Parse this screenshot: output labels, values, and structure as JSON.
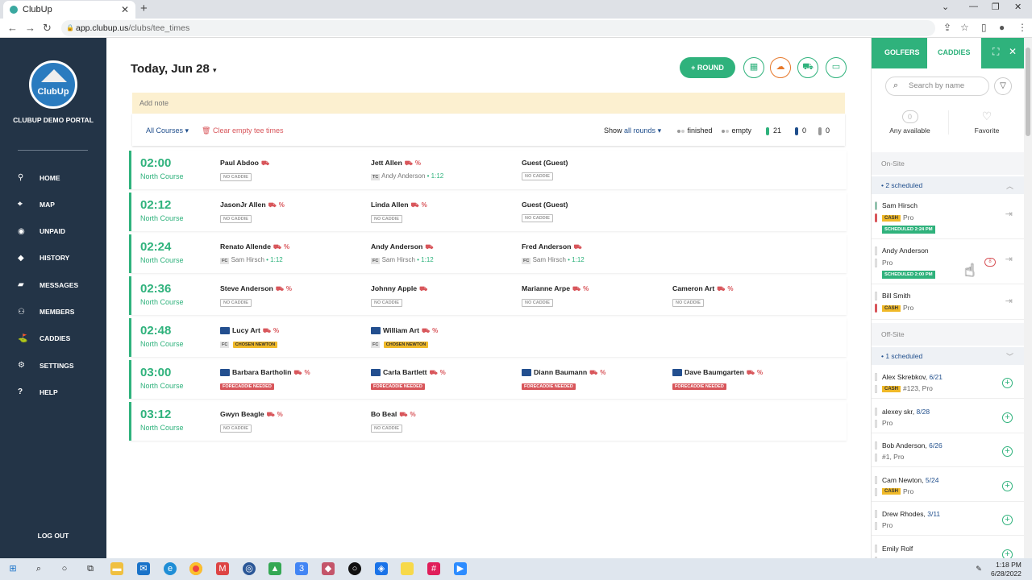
{
  "browser": {
    "tab_title": "ClubUp",
    "url_host": "app.clubup.us",
    "url_path": "/clubs/tee_times"
  },
  "sidebar": {
    "logo_text": "ClubUp",
    "portal_name": "CLUBUP DEMO PORTAL",
    "items": [
      {
        "label": "HOME",
        "icon": "pin-icon"
      },
      {
        "label": "MAP",
        "icon": "map-icon"
      },
      {
        "label": "UNPAID",
        "icon": "unpaid-icon"
      },
      {
        "label": "HISTORY",
        "icon": "history-icon"
      },
      {
        "label": "MESSAGES",
        "icon": "messages-icon"
      },
      {
        "label": "MEMBERS",
        "icon": "members-icon"
      },
      {
        "label": "CADDIES",
        "icon": "caddies-icon"
      },
      {
        "label": "SETTINGS",
        "icon": "gear-icon"
      },
      {
        "label": "HELP",
        "icon": "help-icon"
      }
    ],
    "logout": "LOG OUT"
  },
  "header": {
    "date": "Today, Jun 28",
    "round_button": "ROUND"
  },
  "note": {
    "placeholder": "Add note"
  },
  "filters": {
    "courses": "All Courses",
    "clear": "Clear empty tee times",
    "show_label": "Show",
    "show_value": "all rounds",
    "finished": "finished",
    "empty": "empty",
    "count_green": "21",
    "count_blue": "0",
    "count_gray": "0"
  },
  "tee_times": [
    {
      "time": "02:00",
      "course": "North Course",
      "players": [
        {
          "name": "Paul Abdoo",
          "pct": false,
          "member": false,
          "tag": "NO CADDIE",
          "tag_type": "nocad"
        },
        {
          "name": "Jett Allen",
          "pct": true,
          "member": false,
          "abbr": "TC",
          "caddie": "Andy Anderson",
          "cad_num": "• 1:12"
        },
        {
          "name": "Guest (Guest)",
          "pct": false,
          "car": false,
          "member": false,
          "tag": "NO CADDIE",
          "tag_type": "nocad"
        }
      ]
    },
    {
      "time": "02:12",
      "course": "North Course",
      "players": [
        {
          "name": "JasonJr Allen",
          "pct": true,
          "member": false,
          "tag": "NO CADDIE",
          "tag_type": "nocad"
        },
        {
          "name": "Linda Allen",
          "pct": true,
          "member": false,
          "tag": "NO CADDIE",
          "tag_type": "nocad"
        },
        {
          "name": "Guest (Guest)",
          "pct": false,
          "car": false,
          "member": false,
          "tag": "NO CADDIE",
          "tag_type": "nocad"
        }
      ]
    },
    {
      "time": "02:24",
      "course": "North Course",
      "players": [
        {
          "name": "Renato Allende",
          "pct": true,
          "member": false,
          "abbr": "FC",
          "caddie": "Sam Hirsch",
          "cad_num": "• 1:12"
        },
        {
          "name": "Andy Anderson",
          "pct": false,
          "member": false,
          "abbr": "FC",
          "caddie": "Sam Hirsch",
          "cad_num": "• 1:12"
        },
        {
          "name": "Fred Anderson",
          "pct": false,
          "member": false,
          "abbr": "FC",
          "caddie": "Sam Hirsch",
          "cad_num": "• 1:12"
        }
      ]
    },
    {
      "time": "02:36",
      "course": "North Course",
      "players": [
        {
          "name": "Steve Anderson",
          "pct": true,
          "member": false,
          "tag": "NO CADDIE",
          "tag_type": "nocad"
        },
        {
          "name": "Johnny Apple",
          "pct": false,
          "member": false,
          "tag": "NO CADDIE",
          "tag_type": "nocad"
        },
        {
          "name": "Marianne Arpe",
          "pct": true,
          "member": false,
          "tag": "NO CADDIE",
          "tag_type": "nocad"
        },
        {
          "name": "Cameron Art",
          "pct": true,
          "member": false,
          "tag": "NO CADDIE",
          "tag_type": "nocad"
        }
      ]
    },
    {
      "time": "02:48",
      "course": "North Course",
      "players": [
        {
          "name": "Lucy Art",
          "pct": true,
          "member": true,
          "abbr": "FC",
          "tag": "CHOSEN NEWTON",
          "tag_type": "cn"
        },
        {
          "name": "William Art",
          "pct": true,
          "member": true,
          "abbr": "FC",
          "tag": "CHOSEN NEWTON",
          "tag_type": "cn"
        }
      ]
    },
    {
      "time": "03:00",
      "course": "North Course",
      "players": [
        {
          "name": "Barbara Bartholin",
          "pct": true,
          "member": true,
          "tag": "FORECADDIE NEEDED",
          "tag_type": "fn"
        },
        {
          "name": "Carla Bartlett",
          "pct": true,
          "member": true,
          "tag": "FORECADDIE NEEDED",
          "tag_type": "fn"
        },
        {
          "name": "Diann Baumann",
          "pct": true,
          "member": true,
          "tag": "FORECADDIE NEEDED",
          "tag_type": "fn"
        },
        {
          "name": "Dave Baumgarten",
          "pct": true,
          "member": true,
          "tag": "FORECADDIE NEEDED",
          "tag_type": "fn"
        }
      ]
    },
    {
      "time": "03:12",
      "course": "North Course",
      "players": [
        {
          "name": "Gwyn Beagle",
          "pct": true,
          "member": false,
          "tag": "NO CADDIE",
          "tag_type": "nocad"
        },
        {
          "name": "Bo Beal",
          "pct": true,
          "member": false,
          "tag": "NO CADDIE",
          "tag_type": "nocad"
        }
      ]
    }
  ],
  "rpanel": {
    "tab_golfers": "GOLFERS",
    "tab_caddies": "CADDIES",
    "search_placeholder": "Search by name",
    "opt_any": "Any available",
    "opt_any_count": "0",
    "opt_fav": "Favorite",
    "onsite": "On-Site",
    "onsite_sched": "2 scheduled",
    "offsite": "Off-Site",
    "offsite_sched": "1 scheduled",
    "onsite_caddies": [
      {
        "name": "Sam Hirsch",
        "cash": true,
        "sub": "Pro",
        "sched": "SCHEDULED 2:24 PM",
        "bar": "#2fb27c"
      },
      {
        "name": "Andy Anderson",
        "cash": false,
        "sub": "Pro",
        "sched": "SCHEDULED 2:00 PM",
        "bar": "#fff",
        "badge": "8"
      },
      {
        "name": "Bill Smith",
        "cash": true,
        "sub": "Pro",
        "sched": "",
        "bar": "#fff"
      }
    ],
    "offsite_caddies": [
      {
        "name": "Alex Skrebkov",
        "date": "6/21",
        "cash": true,
        "sub": "#123, Pro"
      },
      {
        "name": "alexey skr",
        "date": "8/28",
        "cash": false,
        "sub": "Pro"
      },
      {
        "name": "Bob Anderson",
        "date": "6/26",
        "cash": false,
        "sub": "#1, Pro"
      },
      {
        "name": "Cam Newton",
        "date": "5/24",
        "cash": true,
        "sub": "Pro"
      },
      {
        "name": "Drew Rhodes",
        "date": "3/11",
        "cash": false,
        "sub": "Pro"
      },
      {
        "name": "Emily Rolf",
        "date": "",
        "cash": false,
        "sub": ""
      }
    ],
    "cash_label": "CASH"
  },
  "taskbar": {
    "time": "1:18 PM",
    "date": "6/28/2022"
  },
  "colors": {
    "accent": "#2fb27c",
    "sidebar": "#233447",
    "warn": "#d8555a",
    "gold": "#f0b928",
    "link": "#1f4e8c"
  }
}
